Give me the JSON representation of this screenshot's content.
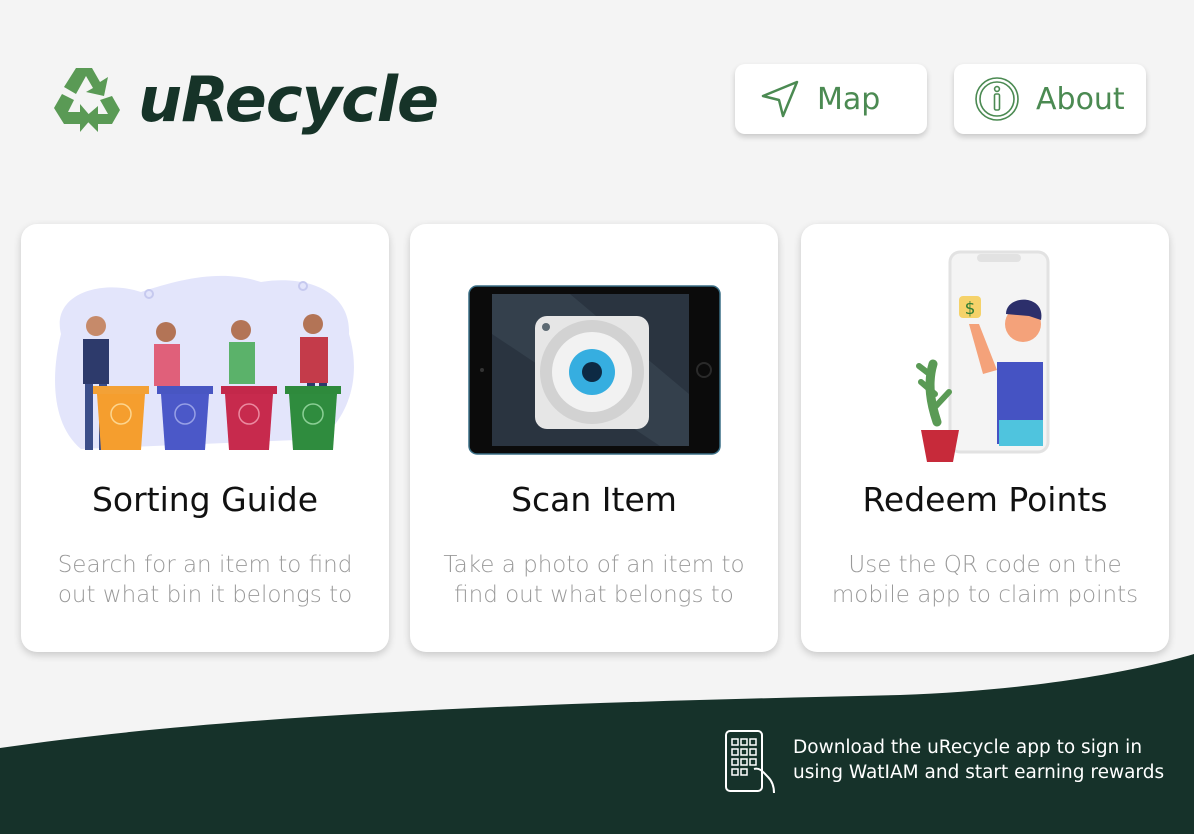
{
  "app": {
    "name": "uRecycle"
  },
  "nav": {
    "map_label": "Map",
    "about_label": "About"
  },
  "cards": [
    {
      "title": "Sorting Guide",
      "description": "Search for an item to find out what bin it belongs to"
    },
    {
      "title": "Scan Item",
      "description": "Take a photo of an item to find out what belongs to"
    },
    {
      "title": "Redeem Points",
      "description": "Use the QR code on the mobile app to claim points"
    }
  ],
  "footer": {
    "download_text": "Download the uRecycle app to sign in using WatIAM and start earning rewards"
  },
  "colors": {
    "brand_dark": "#163328",
    "brand_green": "#4b8a52",
    "background": "#f4f4f4"
  }
}
